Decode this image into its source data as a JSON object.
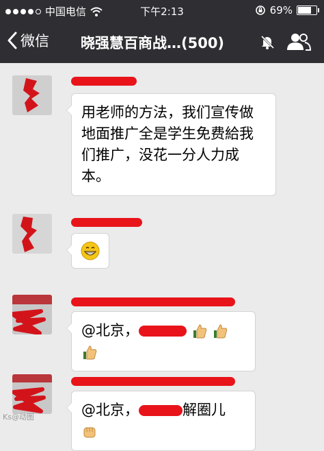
{
  "status_bar": {
    "carrier": "中国电信",
    "time": "下午2:13",
    "battery": "69%",
    "battery_level": 0.69
  },
  "nav": {
    "back_label": "微信",
    "title": "晓强慧百商战…(500)"
  },
  "messages": [
    {
      "text": "用老师的方法，我们宣传做地面推广全是学生免费給我们推广，没花一分人力成本。"
    },
    {
      "text": ""
    },
    {
      "text": "@北京，"
    },
    {
      "text_before": "@北京，",
      "text_after": "解圈儿"
    }
  ],
  "colors": {
    "bar": "#2e2e33",
    "chat_bg": "#ebebeb",
    "redaction": "#e8141a"
  },
  "icons": [
    "chevron-left-icon",
    "mute-bell-icon",
    "group-members-icon",
    "grin-emoji-icon",
    "thumbs-up-icon",
    "fist-icon"
  ],
  "watermark": "Ks@动图"
}
